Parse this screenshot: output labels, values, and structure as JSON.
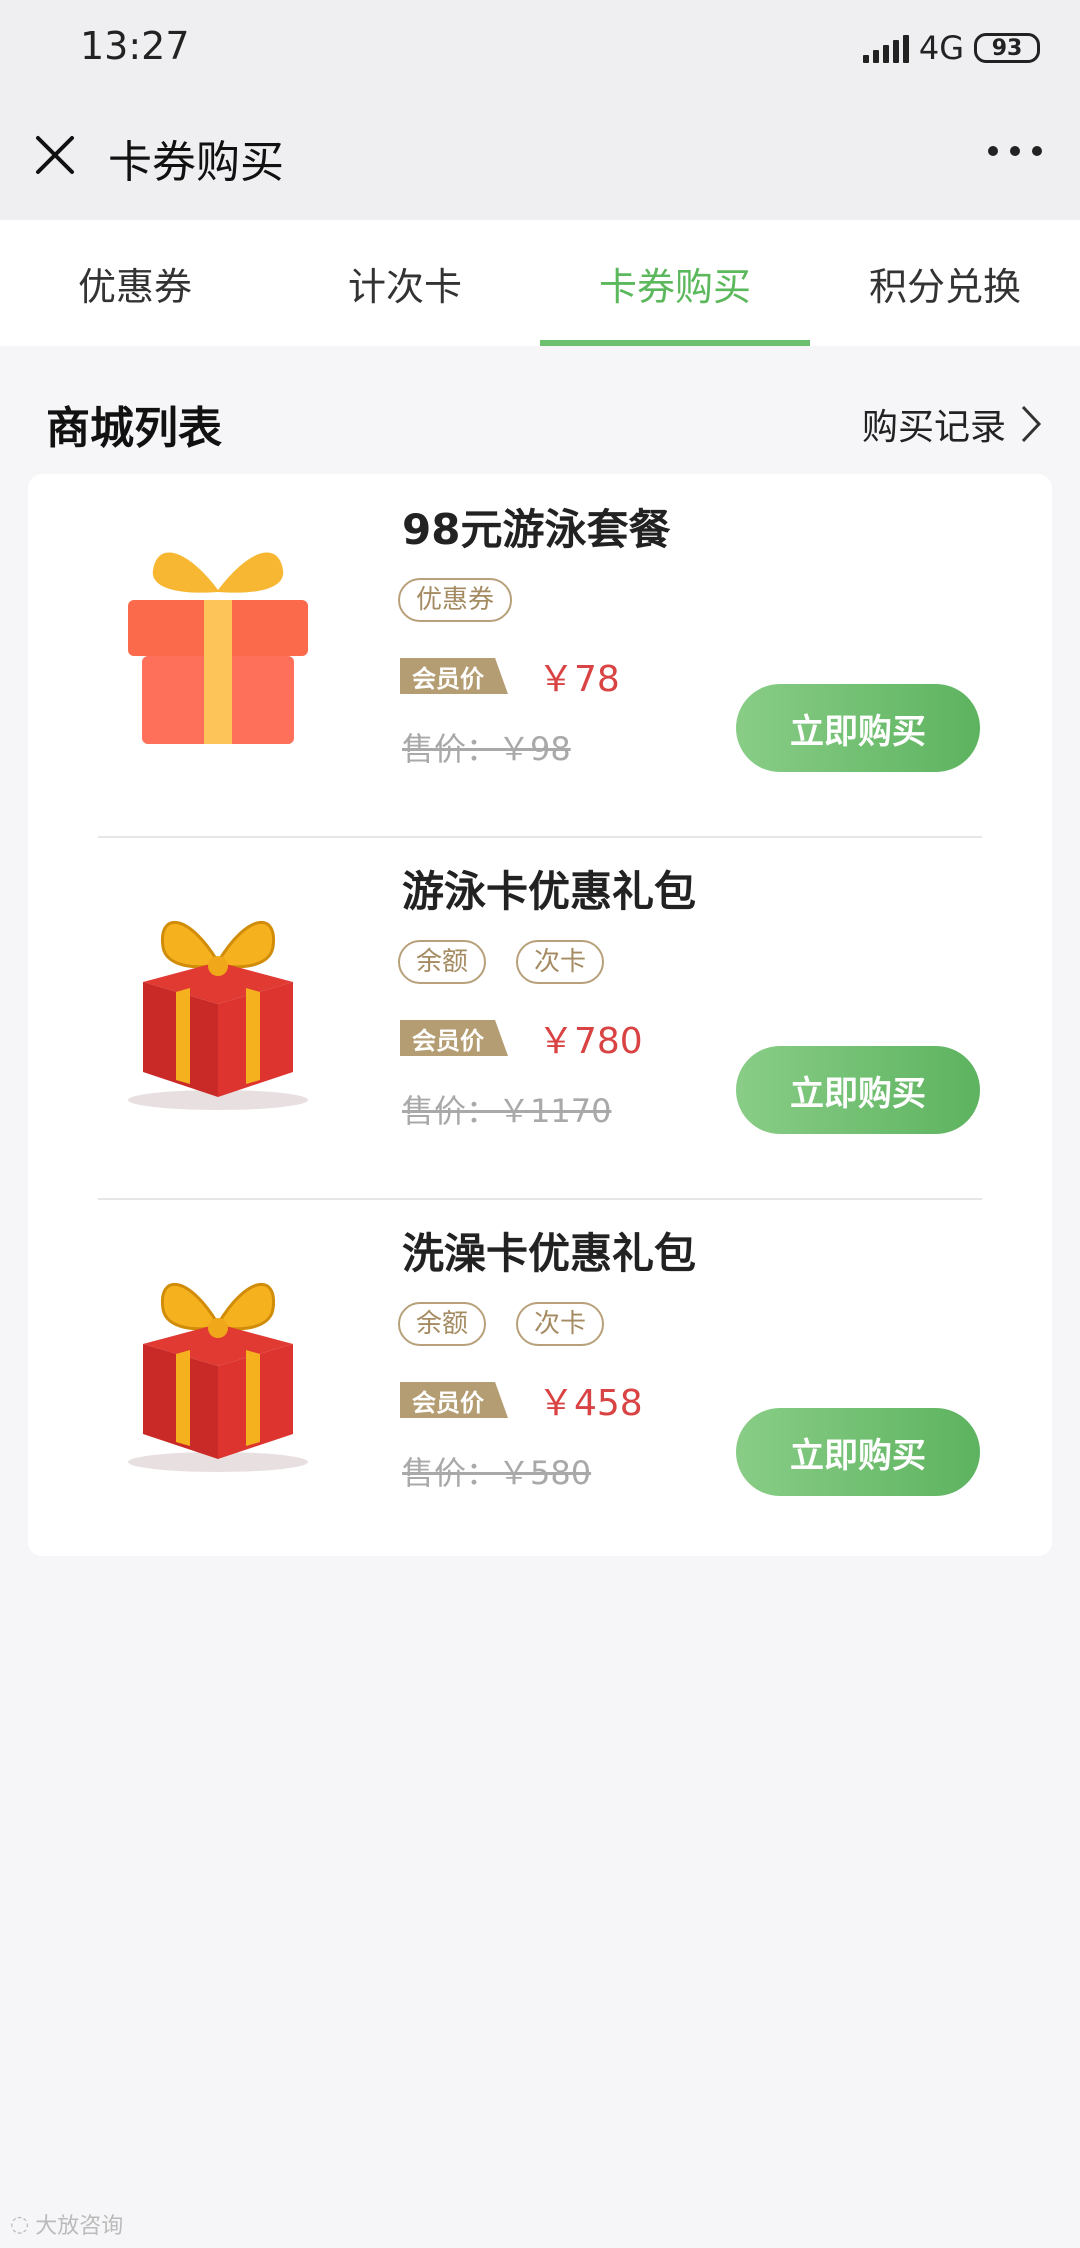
{
  "status_bar": {
    "time": "13:27",
    "network": "4G",
    "battery": "93"
  },
  "nav": {
    "title": "卡券购买"
  },
  "tabs": [
    {
      "label": "优惠券"
    },
    {
      "label": "计次卡"
    },
    {
      "label": "卡券购买",
      "active": true
    },
    {
      "label": "积分兑换"
    }
  ],
  "section": {
    "title": "商城列表",
    "records_link": "购买记录"
  },
  "products": [
    {
      "name": "98元游泳套餐",
      "tags": [
        "优惠券"
      ],
      "member_label": "会员价",
      "member_price": "￥78",
      "original_price": "售价：￥98",
      "buy_label": "立即购买",
      "icon": "gift-box-flat-icon"
    },
    {
      "name": "游泳卡优惠礼包",
      "tags": [
        "余额",
        "次卡"
      ],
      "member_label": "会员价",
      "member_price": "￥780",
      "original_price": "售价：￥1170",
      "buy_label": "立即购买",
      "icon": "gift-box-3d-icon"
    },
    {
      "name": "洗澡卡优惠礼包",
      "tags": [
        "余额",
        "次卡"
      ],
      "member_label": "会员价",
      "member_price": "￥458",
      "original_price": "售价：￥580",
      "buy_label": "立即购买",
      "icon": "gift-box-3d-icon"
    }
  ],
  "watermark": "大放咨询",
  "colors": {
    "accent": "#5cb85c",
    "price": "#d94343",
    "tag": "#b7a07a",
    "button_start": "#89cd87",
    "button_end": "#5db35f"
  }
}
